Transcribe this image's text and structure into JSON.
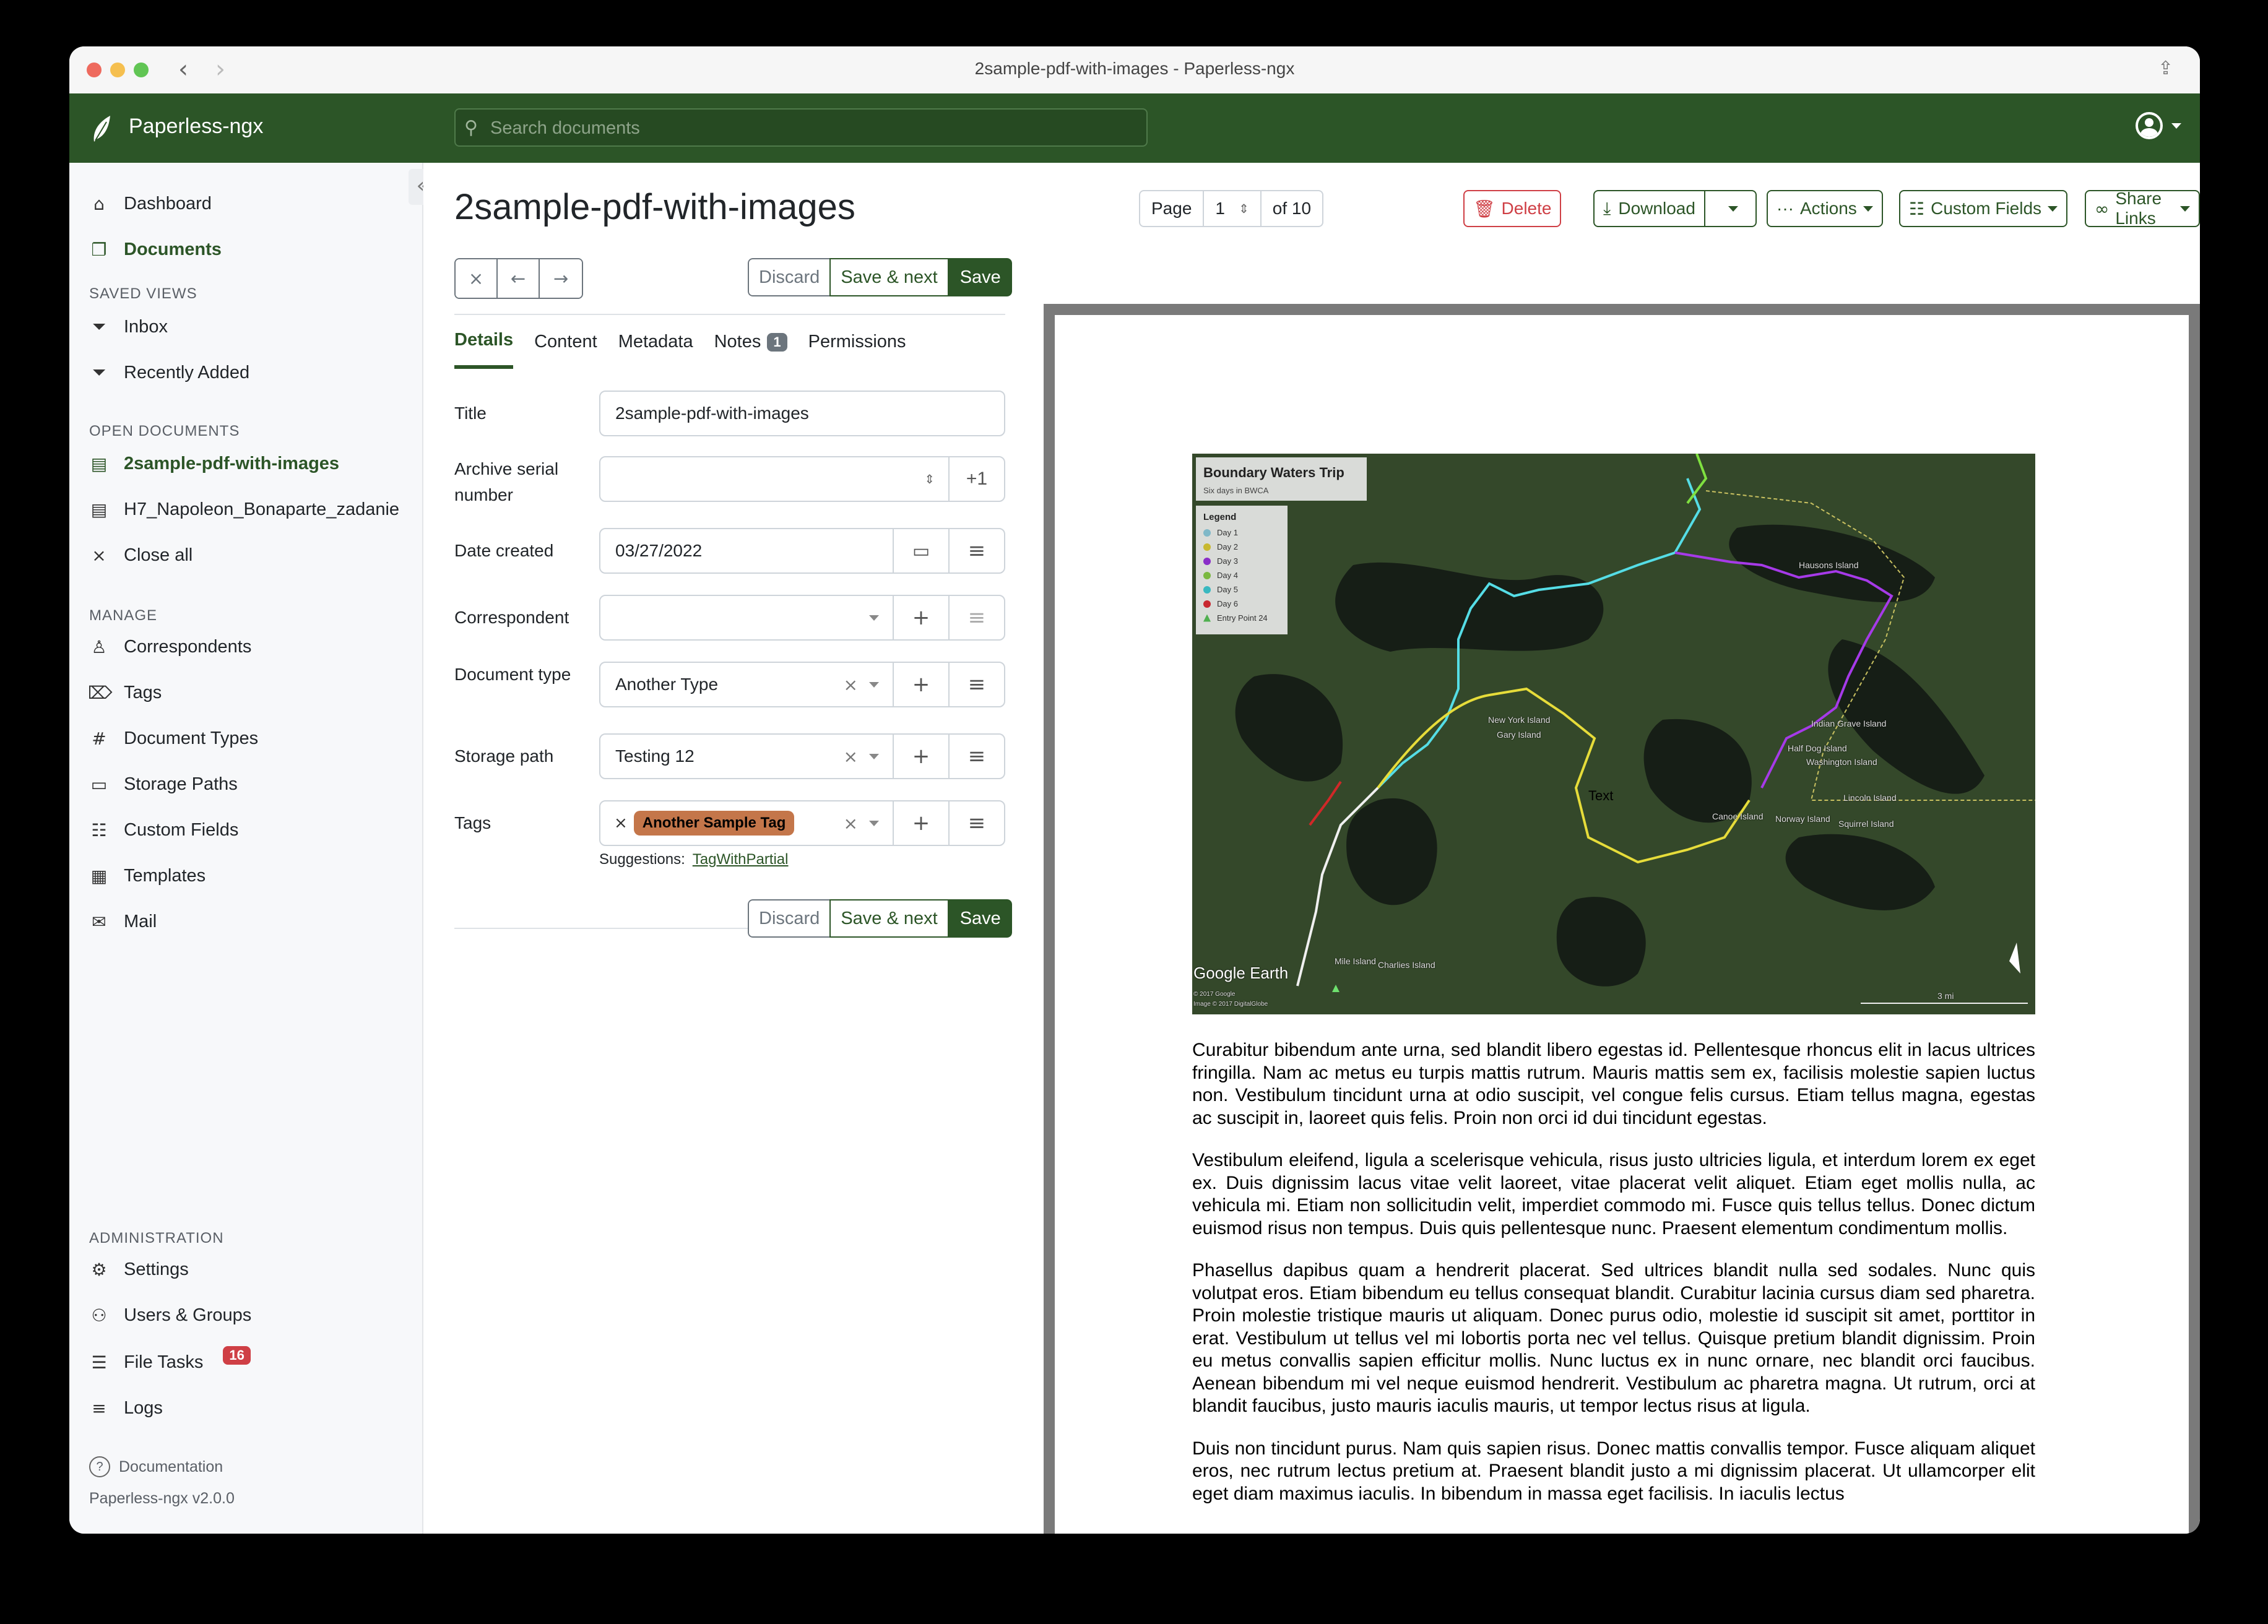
{
  "window": {
    "title": "2sample-pdf-with-images - Paperless-ngx"
  },
  "topbar": {
    "brand": "Paperless-ngx",
    "search_placeholder": "Search documents",
    "icons": {
      "logo": "leaf-icon",
      "search": "search-icon",
      "user": "user-circle-icon"
    }
  },
  "sidebar": {
    "main_items": [
      {
        "label": "Dashboard",
        "icon": "house-icon",
        "active": false
      },
      {
        "label": "Documents",
        "icon": "files-icon",
        "active": true
      }
    ],
    "saved_views_heading": "SAVED VIEWS",
    "saved_views": [
      {
        "label": "Inbox",
        "icon": "funnel-icon"
      },
      {
        "label": "Recently Added",
        "icon": "funnel-icon"
      }
    ],
    "open_documents_heading": "OPEN DOCUMENTS",
    "open_documents": [
      {
        "label": "2sample-pdf-with-images",
        "icon": "file-text-icon",
        "active": true
      },
      {
        "label": "H7_Napoleon_Bonaparte_zadanie",
        "icon": "file-text-icon",
        "active": false
      }
    ],
    "close_all": "Close all",
    "manage_heading": "MANAGE",
    "manage_items": [
      {
        "label": "Correspondents",
        "icon": "person-icon"
      },
      {
        "label": "Tags",
        "icon": "tags-icon"
      },
      {
        "label": "Document Types",
        "icon": "hash-icon"
      },
      {
        "label": "Storage Paths",
        "icon": "folder-icon"
      },
      {
        "label": "Custom Fields",
        "icon": "ui-radios-icon"
      },
      {
        "label": "Templates",
        "icon": "file-ruled-icon"
      },
      {
        "label": "Mail",
        "icon": "envelope-icon"
      }
    ],
    "admin_heading": "ADMINISTRATION",
    "admin_items": [
      {
        "label": "Settings",
        "icon": "gear-icon"
      },
      {
        "label": "Users & Groups",
        "icon": "people-icon"
      },
      {
        "label": "File Tasks",
        "icon": "list-task-icon",
        "badge": "16"
      },
      {
        "label": "Logs",
        "icon": "text-left-icon"
      }
    ],
    "documentation": "Documentation",
    "version": "Paperless-ngx v2.0.0"
  },
  "document": {
    "title": "2sample-pdf-with-images",
    "nav_buttons": {
      "close": "×",
      "previous": "←",
      "next": "→"
    },
    "actions": {
      "discard": "Discard",
      "save_next": "Save & next",
      "save": "Save"
    },
    "tabs": [
      {
        "label": "Details",
        "active": true
      },
      {
        "label": "Content",
        "active": false
      },
      {
        "label": "Metadata",
        "active": false
      },
      {
        "label": "Notes",
        "active": false,
        "badge": "1"
      },
      {
        "label": "Permissions",
        "active": false
      }
    ],
    "fields": {
      "title": {
        "label": "Title",
        "value": "2sample-pdf-with-images"
      },
      "asn": {
        "label": "Archive serial number",
        "value": "",
        "plus_one": "+1"
      },
      "date_created": {
        "label": "Date created",
        "value": "03/27/2022"
      },
      "correspondent": {
        "label": "Correspondent",
        "value": ""
      },
      "document_type": {
        "label": "Document type",
        "value": "Another Type"
      },
      "storage_path": {
        "label": "Storage path",
        "value": "Testing 12"
      },
      "tags": {
        "label": "Tags",
        "values": [
          "Another Sample Tag"
        ],
        "tag_color": "#c4764a"
      },
      "suggestions_label": "Suggestions:",
      "suggestions": [
        "TagWithPartial"
      ]
    }
  },
  "toolbar": {
    "page_label": "Page",
    "page_value": "1",
    "page_of": "of 10",
    "delete": "Delete",
    "download": "Download",
    "actions": "Actions",
    "custom_fields": "Custom Fields",
    "share_links": "Share Links"
  },
  "preview": {
    "map": {
      "title": "Boundary Waters Trip",
      "subtitle": "Six days in BWCA",
      "legend_heading": "Legend",
      "legend": [
        {
          "label": "Day 1",
          "color": "#7fb8c8"
        },
        {
          "label": "Day 2",
          "color": "#c8b830"
        },
        {
          "label": "Day 3",
          "color": "#8a2ec8"
        },
        {
          "label": "Day 4",
          "color": "#7ab840"
        },
        {
          "label": "Day 5",
          "color": "#38b8c0"
        },
        {
          "label": "Day 6",
          "color": "#c82830"
        },
        {
          "label": "Entry Point 24",
          "color": "#50b050"
        }
      ],
      "labels": [
        "Hausons Island",
        "New York Island",
        "Gary Island",
        "Indian Grave Island",
        "Half Dog Island",
        "Washington Island",
        "Lincoln Island",
        "Canoe Island",
        "Norway Island",
        "Squirrel Island",
        "Text",
        "Mile Island",
        "Charlies Island"
      ],
      "attribution": "Google Earth",
      "copyright1": "© 2017 Google",
      "copyright2": "Image © 2017 DigitalGlobe",
      "scale": "3 mi"
    },
    "paragraphs": [
      "Curabitur bibendum ante urna, sed blandit libero egestas id. Pellentesque rhoncus elit in lacus ultrices fringilla. Nam ac metus eu turpis mattis rutrum. Mauris mattis sem ex, facilisis molestie sapien luctus non. Vestibulum tincidunt urna at odio suscipit, vel congue felis cursus. Etiam tellus magna, egestas ac suscipit in, laoreet quis felis. Proin non orci id dui tincidunt egestas.",
      "Vestibulum eleifend, ligula a scelerisque vehicula, risus justo ultricies ligula, et interdum lorem ex eget ex. Duis dignissim lacus vitae velit laoreet, vitae placerat velit aliquet. Etiam eget mollis nulla, ac vehicula mi. Etiam non sollicitudin velit, imperdiet commodo mi. Fusce quis tellus tellus. Donec dictum euismod risus non tempus. Duis quis pellentesque nunc. Praesent elementum condimentum mollis.",
      "Phasellus dapibus quam a hendrerit placerat. Sed ultrices blandit nulla sed sodales. Nunc quis volutpat eros. Etiam bibendum eu tellus consequat blandit. Curabitur lacinia cursus diam sed pharetra. Proin molestie tristique mauris ut aliquam. Donec purus odio, molestie id suscipit sit amet, porttitor in erat. Vestibulum ut tellus vel mi lobortis porta nec vel tellus. Quisque pretium blandit dignissim. Proin eu metus convallis sapien efficitur mollis. Nunc luctus ex in nunc ornare, nec blandit orci faucibus. Aenean bibendum mi vel neque euismod hendrerit. Vestibulum ac pharetra magna. Ut rutrum, orci at blandit faucibus, justo mauris iaculis mauris, ut tempor lectus risus at ligula.",
      "Duis non tincidunt purus. Nam quis sapien risus. Donec mattis convallis tempor. Fusce aliquam aliquet eros, nec rutrum lectus pretium at. Praesent blandit justo a mi dignissim placerat. Ut ullamcorper elit eget diam maximus iaculis. In bibendum in massa eget facilisis. In iaculis lectus"
    ]
  },
  "colors": {
    "brand": "#2c5527",
    "danger": "#cf3f45",
    "muted": "#6c757d"
  }
}
